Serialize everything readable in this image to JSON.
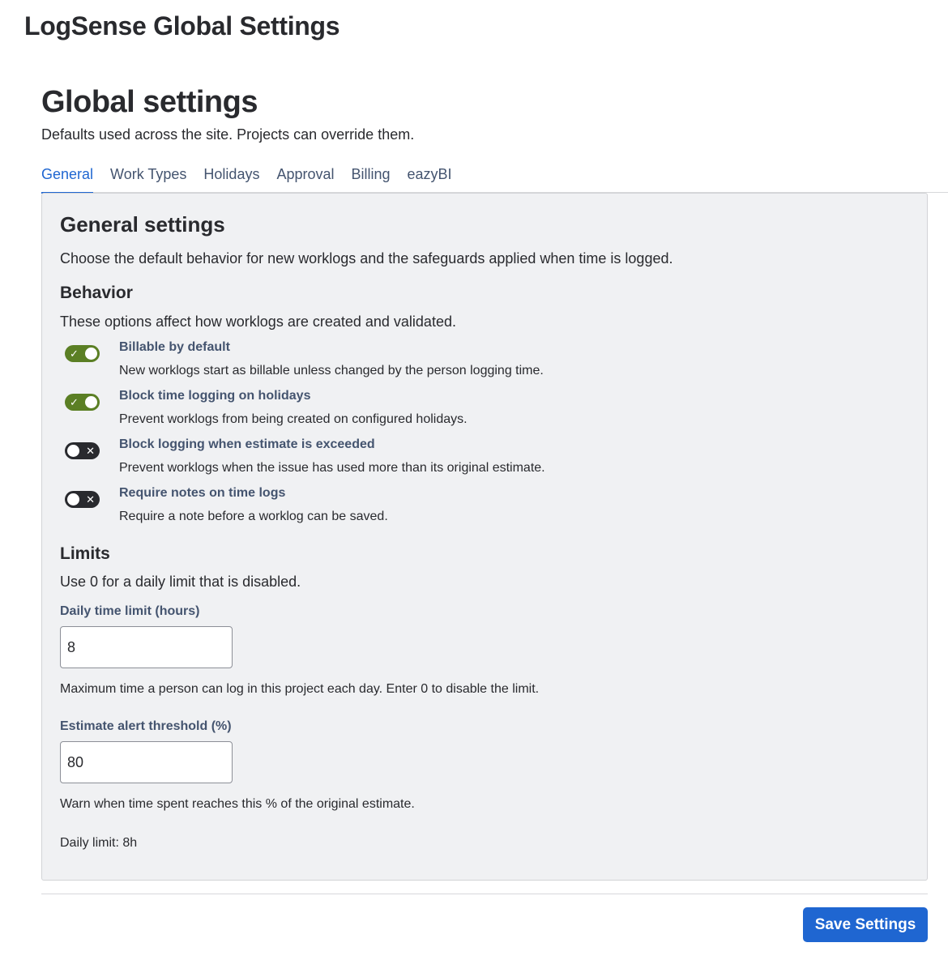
{
  "app": {
    "title": "LogSense Global Settings"
  },
  "page": {
    "title": "Global settings",
    "subtitle": "Defaults used across the site. Projects can override them."
  },
  "tabs": [
    {
      "label": "General",
      "active": true
    },
    {
      "label": "Work Types",
      "active": false
    },
    {
      "label": "Holidays",
      "active": false
    },
    {
      "label": "Approval",
      "active": false
    },
    {
      "label": "Billing",
      "active": false
    },
    {
      "label": "eazyBI",
      "active": false
    }
  ],
  "general": {
    "title": "General settings",
    "description": "Choose the default behavior for new worklogs and the safeguards applied when time is logged.",
    "behavior": {
      "title": "Behavior",
      "description": "These options affect how worklogs are created and validated.",
      "toggles": [
        {
          "label": "Billable by default",
          "help": "New worklogs start as billable unless changed by the person logging time.",
          "enabled": true
        },
        {
          "label": "Block time logging on holidays",
          "help": "Prevent worklogs from being created on configured holidays.",
          "enabled": true
        },
        {
          "label": "Block logging when estimate is exceeded",
          "help": "Prevent worklogs when the issue has used more than its original estimate.",
          "enabled": false
        },
        {
          "label": "Require notes on time logs",
          "help": "Require a note before a worklog can be saved.",
          "enabled": false
        }
      ]
    },
    "limits": {
      "title": "Limits",
      "description": "Use 0 for a daily limit that is disabled.",
      "daily_limit": {
        "label": "Daily time limit (hours)",
        "value": "8",
        "help": "Maximum time a person can log in this project each day. Enter 0 to disable the limit."
      },
      "estimate_threshold": {
        "label": "Estimate alert threshold (%)",
        "value": "80",
        "help": "Warn when time spent reaches this % of the original estimate."
      },
      "status": "Daily limit: 8h"
    }
  },
  "footer": {
    "save_label": "Save Settings"
  },
  "colors": {
    "accent": "#1f66d1",
    "toggle_on": "#5b7f24",
    "toggle_off": "#292a2e",
    "panel_bg": "#f0f1f3"
  },
  "icons": {
    "toggle_on": "check-icon",
    "toggle_off": "cross-icon"
  }
}
